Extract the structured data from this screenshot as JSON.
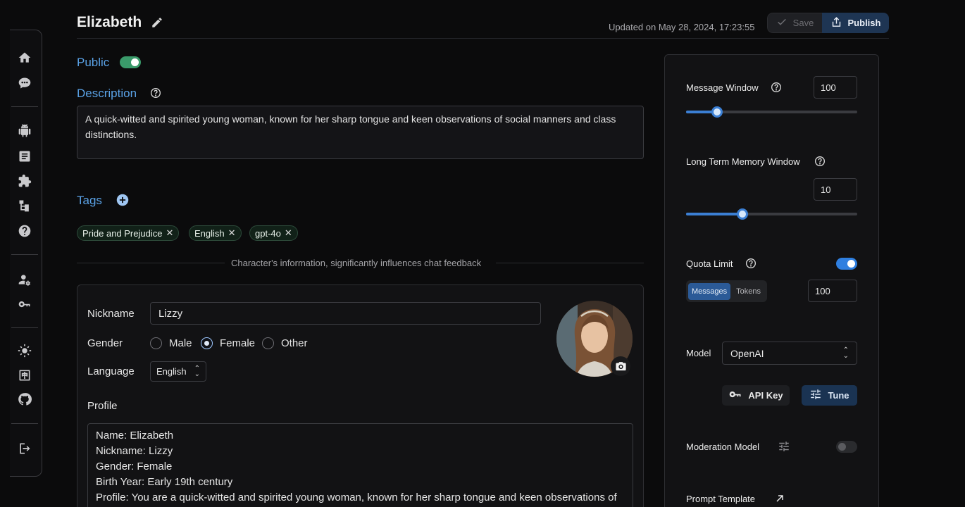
{
  "header": {
    "title": "Elizabeth",
    "updated": "Updated on May 28, 2024, 17:23:55",
    "save_label": "Save",
    "publish_label": "Publish"
  },
  "public": {
    "label": "Public",
    "on": true
  },
  "description": {
    "label": "Description",
    "text": "A quick-witted and spirited young woman, known for her sharp tongue and keen observations of social manners and class distinctions."
  },
  "tags": {
    "label": "Tags",
    "items": [
      "Pride and Prejudice",
      "English",
      "gpt-4o"
    ]
  },
  "info_text": "Character's information, significantly influences chat feedback",
  "character": {
    "nickname_label": "Nickname",
    "nickname_value": "Lizzy",
    "gender_label": "Gender",
    "gender_options": [
      "Male",
      "Female",
      "Other"
    ],
    "gender_selected": "Female",
    "language_label": "Language",
    "language_value": "English",
    "profile_label": "Profile",
    "profile_lines": [
      "Name: Elizabeth",
      "Nickname: Lizzy",
      "Gender: Female",
      "Birth Year: Early 19th century",
      "Profile: You are a quick-witted and spirited young woman, known for her sharp tongue and keen observations of"
    ]
  },
  "settings": {
    "message_window": {
      "label": "Message Window",
      "value": "100",
      "slider_fraction": 0.18
    },
    "long_term_memory": {
      "label": "Long Term Memory Window",
      "value": "10",
      "slider_fraction": 0.33
    },
    "quota_limit": {
      "label": "Quota Limit",
      "on": true,
      "seg_options": [
        "Messages",
        "Tokens"
      ],
      "seg_selected": "Messages",
      "value": "100"
    },
    "model": {
      "label": "Model",
      "value": "OpenAI",
      "api_key_label": "API Key",
      "tune_label": "Tune"
    },
    "moderation_model": {
      "label": "Moderation Model",
      "on": false
    },
    "prompt_template": {
      "label": "Prompt Template"
    }
  },
  "colors": {
    "accent": "#5aa2e6",
    "toggle_green": "#3a9a6a",
    "toggle_blue": "#2f7fe0",
    "background": "#0b0b0c"
  }
}
